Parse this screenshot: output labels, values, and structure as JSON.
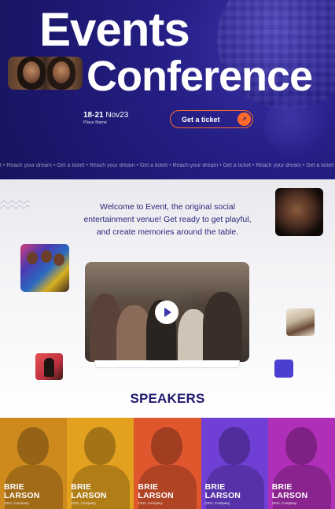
{
  "hero": {
    "title_line1": "Events",
    "title_line2": "Conference",
    "date_days": "18-21",
    "date_month": "Nov23",
    "place": "Place Name",
    "ticket_label": "Get a ticket",
    "marquee": "t  •  Reach your dream  •  Get a ticket  •  Reach your dream  •  Get a ticket  •  Reach your dream  •  Get a ticket  •  Reach your dream  •  Get a ticket  •  Reach your dream  •  Get a ticket  •  Reach your"
  },
  "about": {
    "welcome": "Welcome to Event, the original social entertainment venue! Get ready to get playful, and create memories around the table."
  },
  "speakers_section": {
    "title": "SPEAKERS",
    "items": [
      {
        "first": "BRIE",
        "last": "LARSON",
        "role": "CEO, Company",
        "color": "#cf8a1e"
      },
      {
        "first": "BRIE",
        "last": "LARSON",
        "role": "CEO, Company",
        "color": "#e2a11e"
      },
      {
        "first": "BRIE",
        "last": "LARSON",
        "role": "CEO, Company",
        "color": "#e0572e"
      },
      {
        "first": "BRIE",
        "last": "LARSON",
        "role": "CEO, Company",
        "color": "#6f3fd6"
      },
      {
        "first": "BRIE",
        "last": "LARSON",
        "role": "CEO, Company",
        "color": "#b02fb8"
      }
    ]
  },
  "colors": {
    "hero_bg": "#1d1870",
    "accent_orange": "#ff6a2a",
    "heading_navy": "#1e1a6e",
    "purple_square": "#4a3fd0"
  }
}
